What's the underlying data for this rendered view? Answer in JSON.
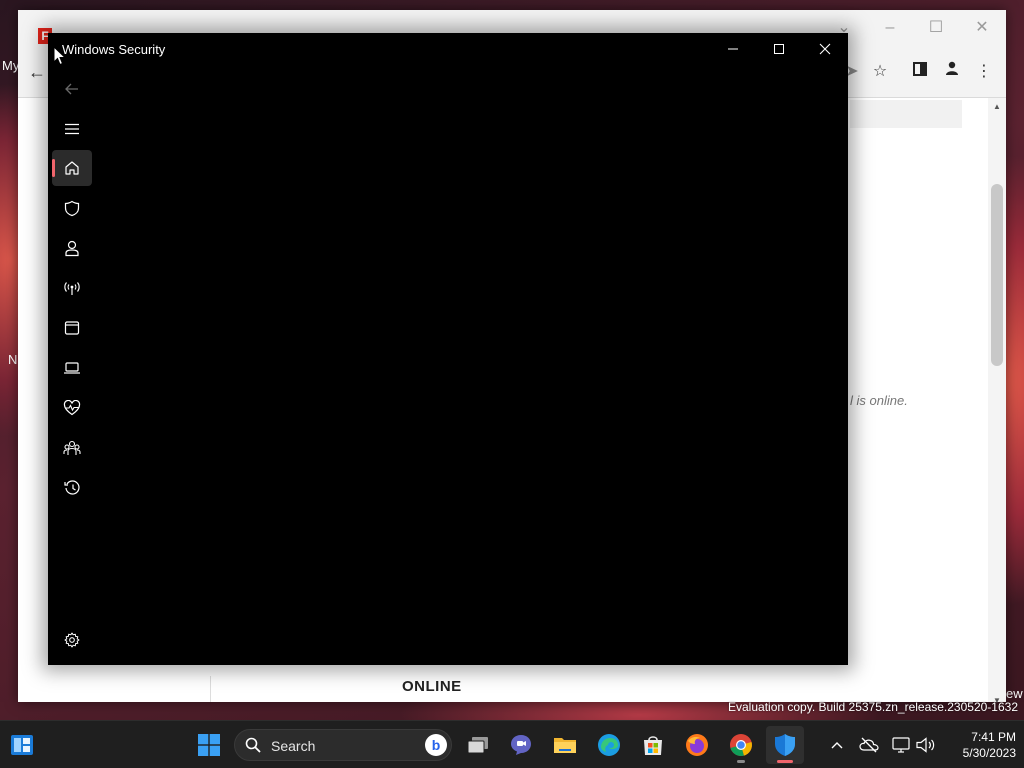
{
  "desktop": {
    "left_label_top": "My",
    "left_label_bottom": "N",
    "right_label": "ew"
  },
  "browser": {
    "favicon_letter": "F",
    "content_italic_text": "l is online.",
    "content_heading": "ONLINE"
  },
  "security_window": {
    "title": "Windows Security",
    "nav_items": [
      {
        "name": "home-icon",
        "label": "Home"
      },
      {
        "name": "shield-icon",
        "label": "Virus & threat protection"
      },
      {
        "name": "account-icon",
        "label": "Account protection"
      },
      {
        "name": "network-icon",
        "label": "Firewall & network protection"
      },
      {
        "name": "app-browser-icon",
        "label": "App & browser control"
      },
      {
        "name": "device-security-icon",
        "label": "Device security"
      },
      {
        "name": "health-icon",
        "label": "Device performance & health"
      },
      {
        "name": "family-icon",
        "label": "Family options"
      },
      {
        "name": "history-icon",
        "label": "Protection history"
      }
    ],
    "settings_label": "Settings"
  },
  "watermark": "Evaluation copy. Build 25375.zn_release.230520-1632",
  "taskbar": {
    "search_label": "Search",
    "time": "7:41 PM",
    "date": "5/30/2023"
  },
  "colors": {
    "accent": "#f0656c",
    "window_bg": "#000000",
    "taskbar_bg": "#1f1f1f"
  }
}
